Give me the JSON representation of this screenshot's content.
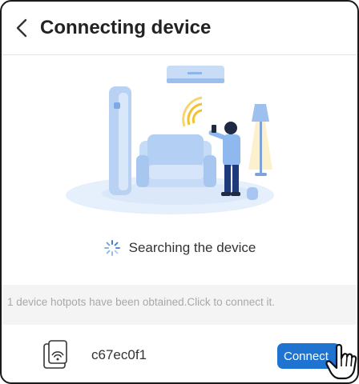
{
  "header": {
    "title": "Connecting device"
  },
  "status": {
    "text": "Searching the device"
  },
  "hint": {
    "text": "1 device hotpots have been obtained.Click to connect it."
  },
  "device": {
    "name": "c67ec0f1",
    "connect_label": "Connect"
  },
  "icons": {
    "back": "chevron-left-icon",
    "spinner": "loading-spinner-icon",
    "device": "wifi-device-icon",
    "cursor": "hand-pointer-icon"
  },
  "colors": {
    "accent": "#1e74d0",
    "hint_bg": "#f4f4f4",
    "hint_text": "#a8a8a8"
  }
}
